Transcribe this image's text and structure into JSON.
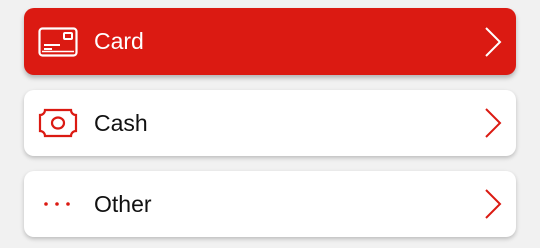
{
  "colors": {
    "accent": "#db1a12",
    "selected_text": "#ffffff",
    "text": "#111111",
    "card_bg": "#ffffff",
    "page_bg": "#f1f1f1"
  },
  "options": [
    {
      "label": "Card",
      "icon": "credit-card-icon",
      "selected": true
    },
    {
      "label": "Cash",
      "icon": "banknote-icon",
      "selected": false
    },
    {
      "label": "Other",
      "icon": "more-dots-icon",
      "selected": false
    }
  ]
}
